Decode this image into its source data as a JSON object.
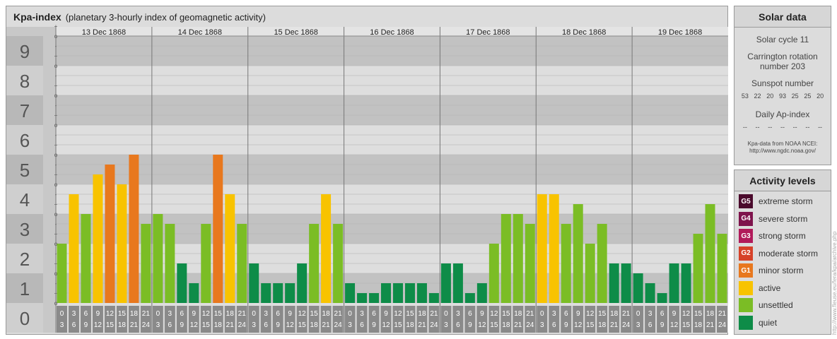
{
  "title": {
    "main": "Kpa-index",
    "sub": "(planetary 3-hourly index of geomagnetic activity)"
  },
  "chart_data": {
    "type": "bar",
    "ylim": [
      0,
      9
    ],
    "y_ticks": [
      "0",
      "1",
      "2",
      "3",
      "4",
      "5",
      "6",
      "7",
      "8",
      "9"
    ],
    "minor_marks": [
      "-",
      "o",
      "+"
    ],
    "days": [
      "13 Dec 1868",
      "14 Dec 1868",
      "15 Dec 1868",
      "16 Dec 1868",
      "17 Dec 1868",
      "18 Dec 1868",
      "19 Dec 1868"
    ],
    "hour_labels": [
      [
        "0",
        "3"
      ],
      [
        "3",
        "6"
      ],
      [
        "6",
        "9"
      ],
      [
        "9",
        "12"
      ],
      [
        "12",
        "15"
      ],
      [
        "15",
        "18"
      ],
      [
        "18",
        "21"
      ],
      [
        "21",
        "24"
      ]
    ],
    "values": [
      [
        2,
        3.667,
        3,
        4.333,
        4.667,
        4,
        5,
        2.667
      ],
      [
        3,
        2.667,
        1.333,
        0.667,
        2.667,
        5,
        3.667,
        2.667
      ],
      [
        1.333,
        0.667,
        0.667,
        0.667,
        1.333,
        2.667,
        3.667,
        2.667
      ],
      [
        0.667,
        0.333,
        0.333,
        0.667,
        0.667,
        0.667,
        0.667,
        0.333
      ],
      [
        1.333,
        1.333,
        0.333,
        0.667,
        2,
        3,
        3,
        2.667
      ],
      [
        3.667,
        3.667,
        2.667,
        3.333,
        2,
        2.667,
        1.333,
        1.333
      ],
      [
        1,
        0.667,
        0.333,
        1.333,
        1.333,
        2.333,
        3.333,
        2.333
      ]
    ],
    "colors": {
      "quiet": "#0e8c48",
      "unsettled": "#7bbd25",
      "active": "#f8c300",
      "G1": "#e8781e",
      "G2": "#d64128",
      "G3": "#b11a5a",
      "G4": "#7e134c",
      "G5": "#4a0a2c"
    }
  },
  "solar": {
    "title": "Solar data",
    "cycle": "Solar cycle 11",
    "carrington": "Carrington rotation number 203",
    "sunspot_label": "Sunspot number",
    "sunspots": [
      "53",
      "22",
      "20",
      "93",
      "25",
      "25",
      "20"
    ],
    "ap_label": "Daily Ap-index",
    "ap": [
      "--",
      "--",
      "--",
      "--",
      "--",
      "--",
      "--"
    ],
    "note1": "Kpa-data from NOAA NCEI:",
    "note2": "http://www.ngdc.noaa.gov/"
  },
  "levels": {
    "title": "Activity levels",
    "items": [
      {
        "badge": "G5",
        "label": "extreme storm",
        "color": "#4a0a2c"
      },
      {
        "badge": "G4",
        "label": "severe storm",
        "color": "#7e134c"
      },
      {
        "badge": "G3",
        "label": "strong storm",
        "color": "#b11a5a"
      },
      {
        "badge": "G2",
        "label": "moderate storm",
        "color": "#d64128"
      },
      {
        "badge": "G1",
        "label": "minor storm",
        "color": "#e8781e"
      },
      {
        "badge": "",
        "label": "active",
        "color": "#f8c300"
      },
      {
        "badge": "",
        "label": "unsettled",
        "color": "#7bbd25"
      },
      {
        "badge": "",
        "label": "quiet",
        "color": "#0e8c48"
      }
    ]
  },
  "credit": "http://www.fleuse.eu/fera/kpa/archive.php"
}
